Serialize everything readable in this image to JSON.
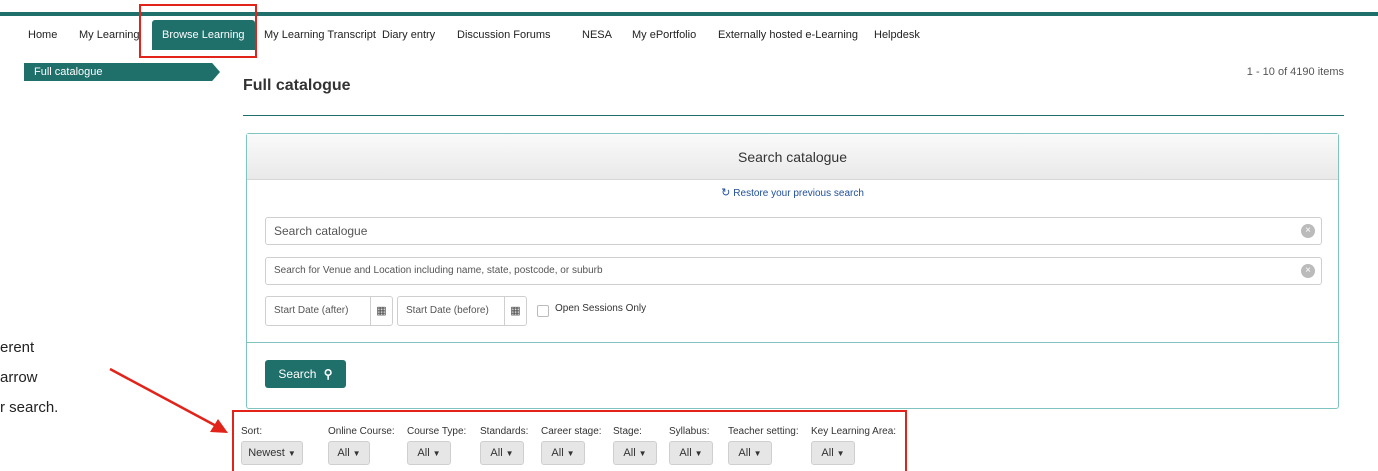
{
  "nav": {
    "items": [
      "Home",
      "My Learning",
      "Browse Learning",
      "My Learning Transcript",
      "Diary entry",
      "Discussion Forums",
      "NESA",
      "My ePortfolio",
      "Externally hosted e-Learning",
      "Helpdesk"
    ],
    "active": "Browse Learning"
  },
  "sidebar": {
    "tab_label": "Full catalogue"
  },
  "page": {
    "title": "Full catalogue",
    "item_count": "1 - 10 of 4190 items"
  },
  "search_panel": {
    "heading": "Search catalogue",
    "restore_label": "Restore your previous search",
    "catalogue_placeholder": "Search catalogue",
    "venue_placeholder": "Search for Venue and Location including name, state, postcode, or suburb",
    "start_after_placeholder": "Start Date (after)",
    "start_before_placeholder": "Start Date (before)",
    "open_sessions_label": "Open Sessions Only",
    "search_button_label": "Search"
  },
  "filters": [
    {
      "label": "Sort:",
      "value": "Newest"
    },
    {
      "label": "Online Course:",
      "value": "All"
    },
    {
      "label": "Course Type:",
      "value": "All"
    },
    {
      "label": "Standards:",
      "value": "All"
    },
    {
      "label": "Career stage:",
      "value": "All"
    },
    {
      "label": "Stage:",
      "value": "All"
    },
    {
      "label": "Syllabus:",
      "value": "All"
    },
    {
      "label": "Teacher setting:",
      "value": "All"
    },
    {
      "label": "Key Learning Area:",
      "value": "All"
    }
  ],
  "annotation": {
    "lines": [
      "erent",
      "arrow",
      "r search."
    ],
    "highlight_color": "#e2231a"
  },
  "colors": {
    "accent": "#1f6f6b",
    "highlight": "#e2231a"
  },
  "icons": {
    "restore": "refresh-icon",
    "clear": "clear-circle-icon",
    "calendar": "calendar-icon",
    "search": "magnifier-icon",
    "caret": "caret-down-icon"
  }
}
